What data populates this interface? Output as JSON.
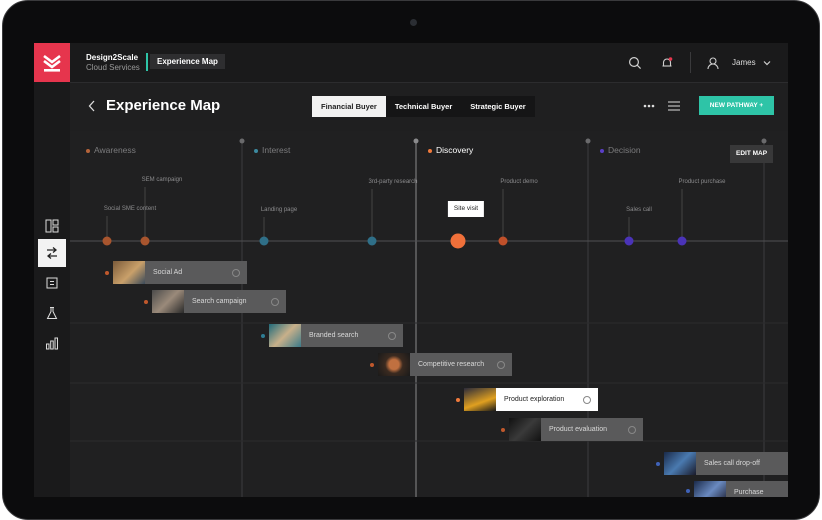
{
  "brand": {
    "name": "Design2Scale",
    "sub": "Cloud Services"
  },
  "breadcrumb": "Experience Map",
  "user": {
    "name": "James"
  },
  "page_title": "Experience Map",
  "tabs": [
    {
      "label": "Financial Buyer",
      "selected": true
    },
    {
      "label": "Technical Buyer",
      "selected": false
    },
    {
      "label": "Strategic Buyer",
      "selected": false
    }
  ],
  "new_pathway": "NEW PATHWAY  +",
  "edit_map": "EDIT MAP",
  "stages": [
    {
      "label": "Awareness",
      "color": "#b5643a"
    },
    {
      "label": "Interest",
      "color": "#3c8aa0"
    },
    {
      "label": "Discovery",
      "color": "#f07a3c",
      "current": true
    },
    {
      "label": "Decision",
      "color": "#5a3fc8"
    }
  ],
  "touchpoints": [
    {
      "label": "Social SME content",
      "color": "#a8552e"
    },
    {
      "label": "SEM campaign",
      "color": "#a8552e"
    },
    {
      "label": "Landing page",
      "color": "#2f6f88"
    },
    {
      "label": "3rd-party research",
      "color": "#2f6f88"
    },
    {
      "label": "Site visit",
      "color": "#f0703a",
      "active": true
    },
    {
      "label": "Product demo",
      "color": "#c0502a"
    },
    {
      "label": "Sales call",
      "color": "#4a33b8"
    },
    {
      "label": "Product purchase",
      "color": "#4a33b8"
    }
  ],
  "cards": [
    {
      "label": "Social Ad",
      "color": "#c0582c"
    },
    {
      "label": "Search campaign",
      "color": "#c0582c"
    },
    {
      "label": "Branded search",
      "color": "#2e7d93"
    },
    {
      "label": "Competitive research",
      "color": "#c0582c"
    },
    {
      "label": "Product exploration",
      "color": "#f07a3c",
      "highlight": true
    },
    {
      "label": "Product evaluation",
      "color": "#c0582c"
    },
    {
      "label": "Sales call drop-off",
      "color": "#3f62b8"
    },
    {
      "label": "Purchase",
      "color": "#3f62b8"
    }
  ],
  "colors": {
    "accent": "#2ec4a7",
    "brand": "#e6354d",
    "background": "#1f1f20"
  }
}
